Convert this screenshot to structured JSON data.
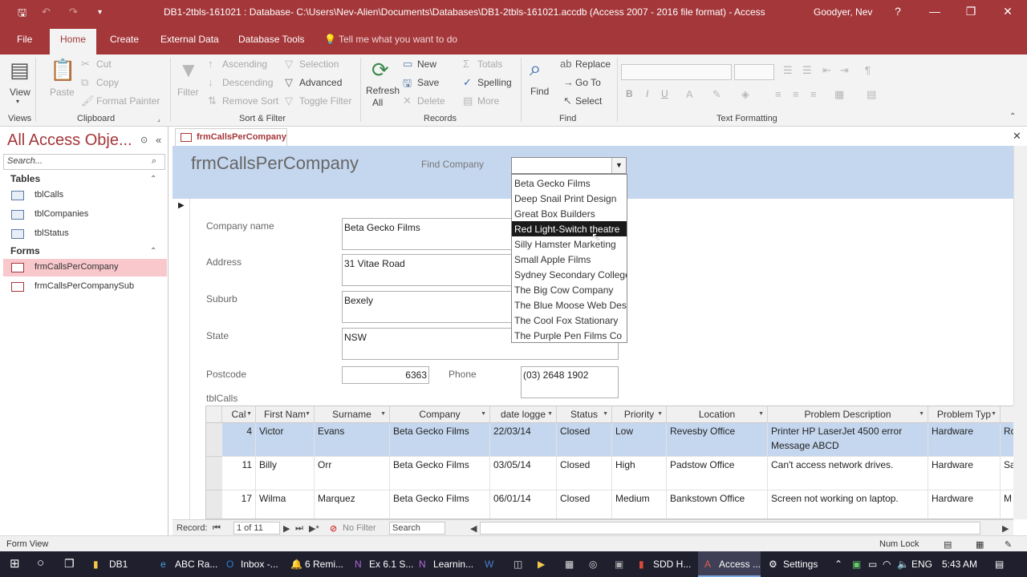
{
  "title_bar": {
    "title": "DB1-2tbls-161021 : Database- C:\\Users\\Nev-Alien\\Documents\\Databases\\DB1-2tbls-161021.accdb (Access 2007 - 2016 file format)  -  Access",
    "user": "Goodyer, Nev",
    "help": "?",
    "minimize": "—",
    "restore": "❐",
    "close": "✕"
  },
  "quick_access": {
    "save": "🖫",
    "undo": "↶",
    "redo": "↷",
    "more": "▾"
  },
  "ribbon_tabs": [
    "File",
    "Home",
    "Create",
    "External Data",
    "Database Tools"
  ],
  "tell_me": "Tell me what you want to do",
  "ribbon": {
    "views": {
      "view": "View",
      "group": "Views"
    },
    "clipboard": {
      "paste": "Paste",
      "cut": "Cut",
      "copy": "Copy",
      "format_painter": "Format Painter",
      "group": "Clipboard"
    },
    "sort_filter": {
      "filter": "Filter",
      "ascending": "Ascending",
      "descending": "Descending",
      "remove_sort": "Remove Sort",
      "selection": "Selection",
      "advanced": "Advanced",
      "toggle_filter": "Toggle Filter",
      "group": "Sort & Filter"
    },
    "records": {
      "refresh": "Refresh",
      "refresh_all": "All",
      "new": "New",
      "save": "Save",
      "delete": "Delete",
      "totals": "Totals",
      "spelling": "Spelling",
      "more": "More",
      "group": "Records"
    },
    "find": {
      "find": "Find",
      "replace": "Replace",
      "goto": "Go To",
      "select": "Select",
      "group": "Find"
    },
    "text_formatting": {
      "bold": "B",
      "italic": "I",
      "underline": "U",
      "group": "Text Formatting"
    }
  },
  "nav_pane": {
    "title": "All Access Obje...",
    "search_placeholder": "Search...",
    "tables_header": "Tables",
    "tables": [
      "tblCalls",
      "tblCompanies",
      "tblStatus"
    ],
    "forms_header": "Forms",
    "forms": [
      "frmCallsPerCompany",
      "frmCallsPerCompanySub"
    ]
  },
  "doc_tab": "frmCallsPerCompany",
  "form": {
    "title": "frmCallsPerCompany",
    "find_company_label": "Find Company",
    "find_company_value": "",
    "dropdown_items": [
      "Beta Gecko Films",
      "Deep Snail Print Design",
      "Great Box Builders",
      "Red Light-Switch theatre",
      "Silly Hamster Marketing",
      "Small Apple Films",
      "Sydney Secondary College",
      "The Big Cow Company",
      "The Blue Moose Web Design",
      "The Cool Fox Stationary",
      "The Purple Pen Films Co"
    ],
    "dropdown_selected_index": 3,
    "company_name_label": "Company name",
    "company_name": "Beta Gecko Films",
    "address_label": "Address",
    "address": "31 Vitae Road",
    "suburb_label": "Suburb",
    "suburb": "Bexely",
    "state_label": "State",
    "state": "NSW",
    "postcode_label": "Postcode",
    "postcode": "6363",
    "phone_label": "Phone",
    "phone": "(03) 2648 1902",
    "subform_label": "tblCalls"
  },
  "subform": {
    "columns": [
      "Cal",
      "First Nam",
      "Surname",
      "Company",
      "date logge",
      "Status",
      "Priority",
      "Location",
      "Problem Description",
      "Problem Typ",
      "Re"
    ],
    "rows": [
      [
        "4",
        "Victor",
        "Evans",
        "Beta Gecko Films",
        "22/03/14",
        "Closed",
        "Low",
        "Revesby Office",
        "Printer HP LaserJet 4500 error",
        "Hardware",
        "Ro"
      ],
      [
        "11",
        "Billy",
        "Orr",
        "Beta Gecko Films",
        "03/05/14",
        "Closed",
        "High",
        "Padstow Office",
        "Can't access network drives.",
        "Hardware",
        "Sa"
      ],
      [
        "17",
        "Wilma",
        "Marquez",
        "Beta Gecko Films",
        "06/01/14",
        "Closed",
        "Medium",
        "Bankstown Office",
        "Screen not working on laptop.",
        "Hardware",
        "M"
      ]
    ],
    "row0_desc_line2": "Message ABCD"
  },
  "record_nav": {
    "label": "Record:",
    "position": "1 of 11",
    "no_filter": "No Filter",
    "search": "Search"
  },
  "status_bar": {
    "left": "Form View",
    "num_lock": "Num Lock"
  },
  "taskbar": {
    "items": [
      "DB1",
      "ABC Ra...",
      "Inbox -...",
      "6 Remi...",
      "Ex 6.1 S...",
      "Learnin...",
      "SDD H...",
      "Access ...",
      "Settings"
    ],
    "lang": "ENG",
    "time": "5:43 AM"
  }
}
